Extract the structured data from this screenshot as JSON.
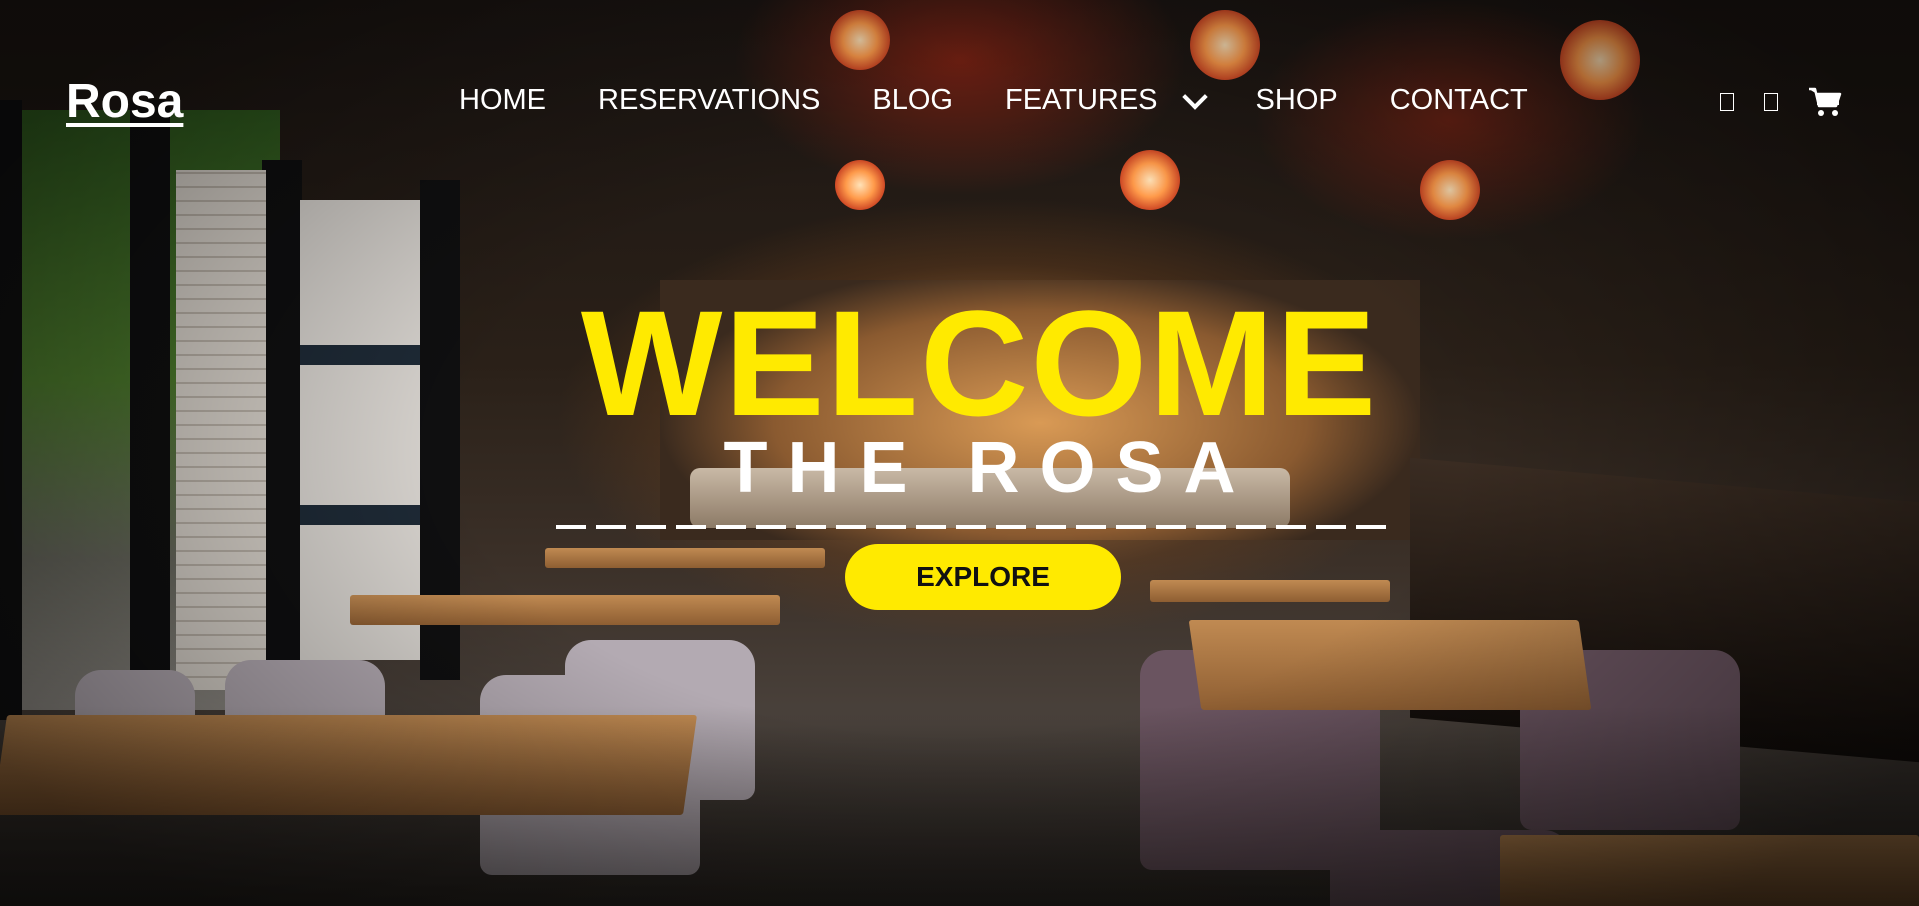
{
  "brand": {
    "logo": "Rosa"
  },
  "nav": {
    "items": [
      {
        "label": "HOME"
      },
      {
        "label": "RESERVATIONS"
      },
      {
        "label": "BLOG"
      },
      {
        "label": "FEATURES",
        "has_dropdown": true
      },
      {
        "label": "SHOP"
      },
      {
        "label": "CONTACT"
      }
    ],
    "icons": [
      "search-icon",
      "user-icon",
      "cart-icon"
    ]
  },
  "hero": {
    "title": "WELCOME",
    "subtitle": "THE ROSA",
    "cta_label": "EXPLORE"
  },
  "colors": {
    "accent": "#ffea00",
    "text": "#ffffff",
    "button_text": "#111111"
  }
}
